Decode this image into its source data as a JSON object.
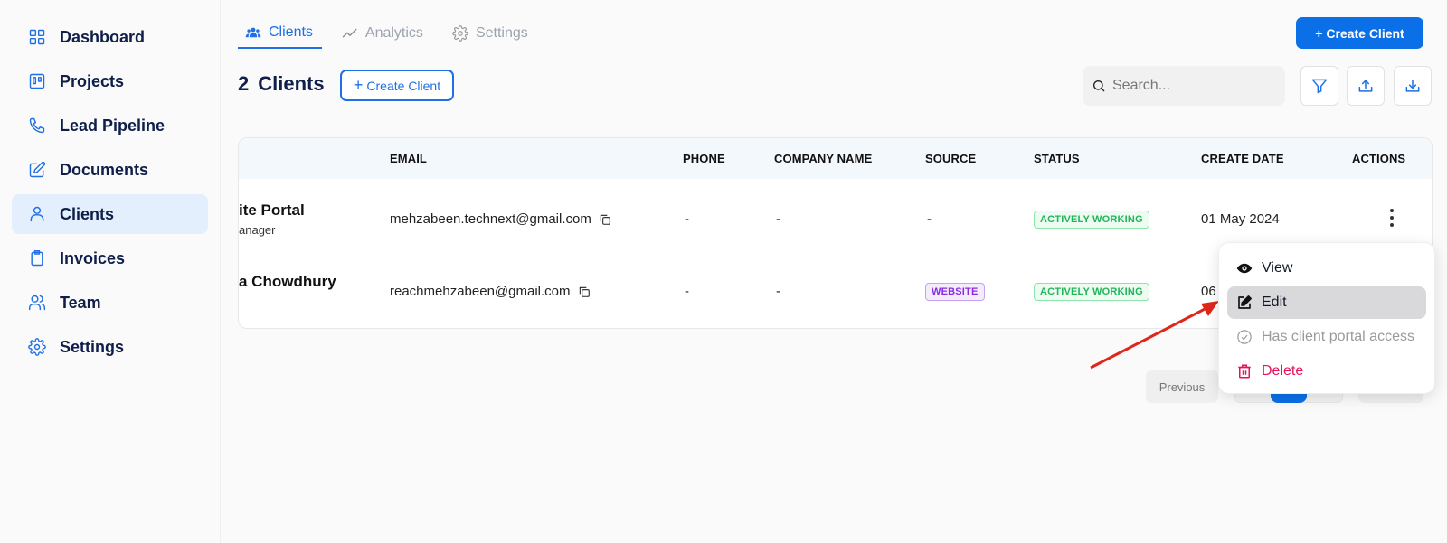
{
  "sidebar": {
    "items": [
      {
        "label": "Dashboard",
        "icon": "grid-icon",
        "active": false
      },
      {
        "label": "Projects",
        "icon": "kanban-icon",
        "active": false
      },
      {
        "label": "Lead Pipeline",
        "icon": "phone-icon",
        "active": false
      },
      {
        "label": "Documents",
        "icon": "edit-document-icon",
        "active": false
      },
      {
        "label": "Clients",
        "icon": "user-icon",
        "active": true
      },
      {
        "label": "Invoices",
        "icon": "clipboard-icon",
        "active": false
      },
      {
        "label": "Team",
        "icon": "users-icon",
        "active": false
      },
      {
        "label": "Settings",
        "icon": "gear-icon",
        "active": false
      }
    ]
  },
  "tabs": [
    {
      "label": "Clients",
      "icon": "users-icon",
      "active": true
    },
    {
      "label": "Analytics",
      "icon": "trend-icon",
      "active": false
    },
    {
      "label": "Settings",
      "icon": "gear-icon",
      "active": false
    }
  ],
  "header": {
    "create_button": "+ Create Client",
    "count": "2",
    "count_label": "Clients",
    "create_outline_plus": "+",
    "create_outline_label": "Create Client",
    "search_placeholder": "Search..."
  },
  "table": {
    "columns": [
      "EMAIL",
      "PHONE",
      "COMPANY NAME",
      "SOURCE",
      "STATUS",
      "CREATE DATE",
      "ACTIONS"
    ],
    "rows": [
      {
        "name": "ite Portal",
        "subtitle": "anager",
        "email": "mehzabeen.technext@gmail.com",
        "phone": "-",
        "company": "-",
        "source": "-",
        "status": "ACTIVELY WORKING",
        "date": "01 May 2024"
      },
      {
        "name": "a Chowdhury",
        "subtitle": "",
        "email": "reachmehzabeen@gmail.com",
        "phone": "-",
        "company": "-",
        "source": "WEBSITE",
        "status": "ACTIVELY WORKING",
        "date": "06"
      }
    ]
  },
  "pagination": {
    "previous": "Previous"
  },
  "menu": {
    "items": [
      {
        "label": "View",
        "icon": "eye-icon"
      },
      {
        "label": "Edit",
        "icon": "pencil-square-icon"
      },
      {
        "label": "Has client portal access",
        "icon": "check-circle-icon"
      },
      {
        "label": "Delete",
        "icon": "trash-icon"
      }
    ]
  },
  "colors": {
    "primary": "#0b6fe8",
    "sidebar_active_bg": "#e3effc",
    "status_green": "#22b55a",
    "source_purple": "#8a2be2",
    "danger": "#e8115a",
    "annotation_arrow": "#e0261b"
  }
}
